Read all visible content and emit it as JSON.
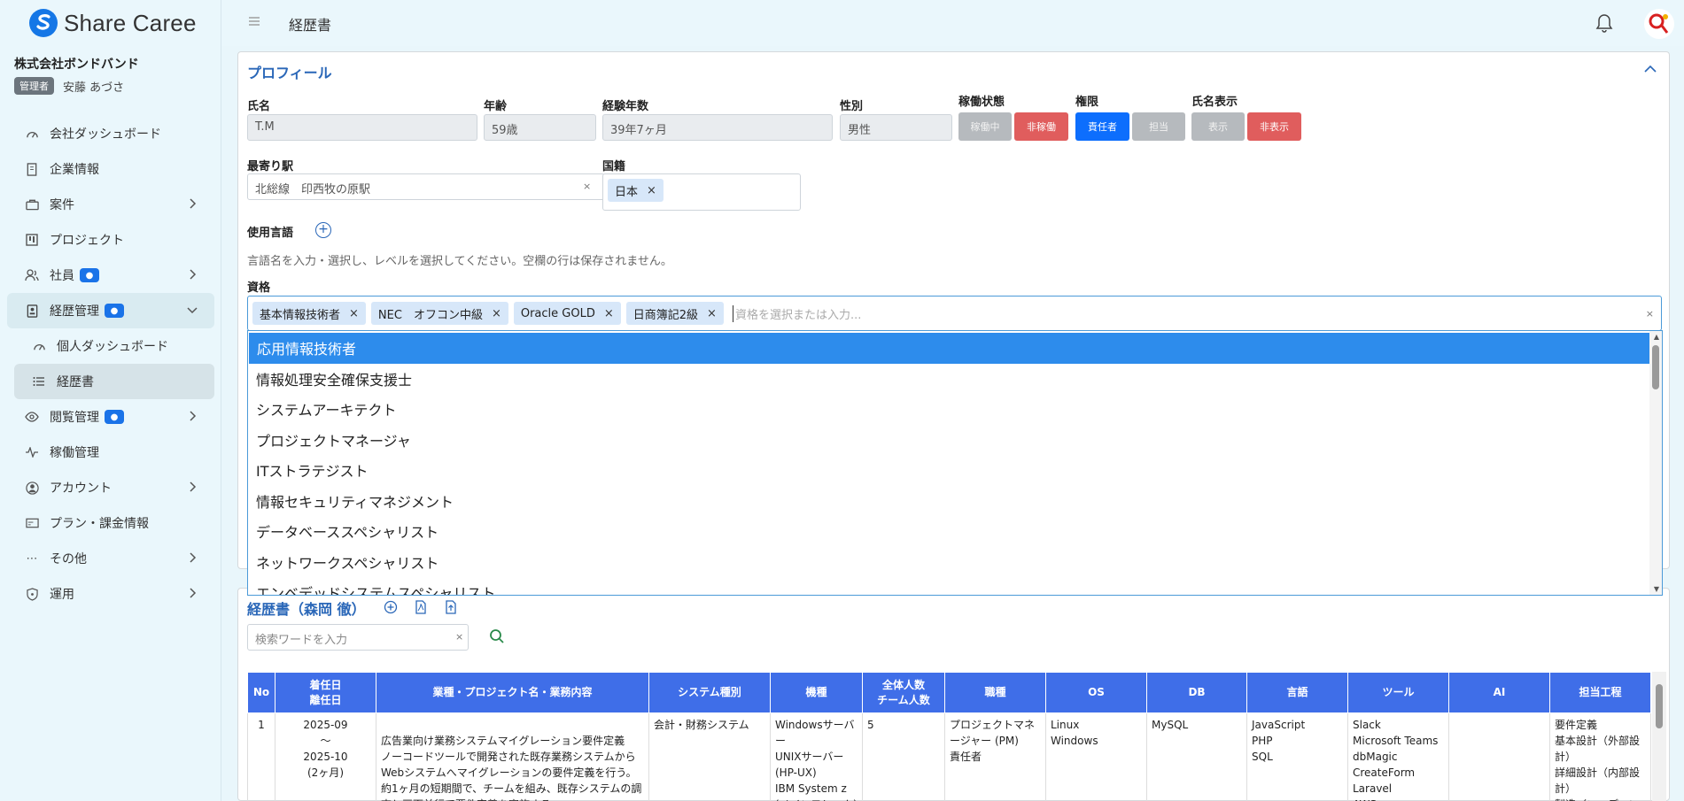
{
  "app": {
    "name": "Share Caree"
  },
  "sidebar": {
    "company": "株式会社ボンドバンド",
    "role_badge": "管理者",
    "user_name": "安藤 あづさ",
    "items": [
      {
        "label": "会社ダッシュボード",
        "icon": "dashboard-icon"
      },
      {
        "label": "企業情報",
        "icon": "building-icon"
      },
      {
        "label": "案件",
        "icon": "briefcase-icon"
      },
      {
        "label": "プロジェクト",
        "icon": "project-icon"
      },
      {
        "label": "社員",
        "icon": "users-icon"
      },
      {
        "label": "経歴管理",
        "icon": "id-card-icon"
      },
      {
        "label": "個人ダッシュボード",
        "icon": "dashboard-icon"
      },
      {
        "label": "経歴書",
        "icon": "list-icon"
      },
      {
        "label": "閲覧管理",
        "icon": "eye-icon"
      },
      {
        "label": "稼働管理",
        "icon": "activity-icon"
      },
      {
        "label": "アカウント",
        "icon": "account-icon"
      },
      {
        "label": "プラン・課金情報",
        "icon": "billing-icon"
      },
      {
        "label": "その他",
        "icon": "more-icon"
      },
      {
        "label": "運用",
        "icon": "shield-icon"
      }
    ]
  },
  "header": {
    "title": "経歴書"
  },
  "profile": {
    "title": "プロフィール",
    "name_label": "氏名",
    "name_value": "T.M",
    "age_label": "年齢",
    "age_value": "59歳",
    "exp_label": "経験年数",
    "exp_value": "39年7ヶ月",
    "gender_label": "性別",
    "gender_value": "男性",
    "status_label": "稼働状態",
    "status_active": "稼働中",
    "status_inactive": "非稼働",
    "perm_label": "権限",
    "perm_lead": "責任者",
    "perm_member": "担当",
    "disp_label": "氏名表示",
    "disp_show": "表示",
    "disp_hide": "非表示",
    "station_label": "最寄り駅",
    "station_value": "北総線　印西牧の原駅",
    "nation_label": "国籍",
    "nation_tag": "日本",
    "lang_label": "使用言語",
    "lang_hint": "言語名を入力・選択し、レベルを選択してください。空欄の行は保存されません。",
    "qual_label": "資格",
    "qual_tags": [
      "基本情報技術者",
      "NEC　オフコン中級",
      "Oracle GOLD",
      "日商簿記2級"
    ],
    "qual_placeholder": "資格を選択または入力..."
  },
  "dropdown": {
    "options": [
      "応用情報技術者",
      "情報処理安全確保支援士",
      "システムアーキテクト",
      "プロジェクトマネージャ",
      "ITストラテジスト",
      "情報セキュリティマネジメント",
      "データベーススペシャリスト",
      "ネットワークスペシャリスト",
      "エンベデッドシステムスペシャリスト"
    ]
  },
  "history": {
    "title": "経歴書（森岡 徹）",
    "search_placeholder": "検索ワードを入力",
    "headers": [
      "No",
      "着任日\n離任日",
      "業種・プロジェクト名・業務内容",
      "システム種別",
      "機種",
      "全体人数\nチーム人数",
      "職種",
      "OS",
      "DB",
      "言語",
      "ツール",
      "AI",
      "担当工程"
    ],
    "rows": [
      {
        "no": "1",
        "dates": "2025-09\n～\n2025-10\n(2ヶ月)",
        "content": "\n広告業向け業務システムマイグレーション要件定義\nノーコードツールで開発された既存業務システムからWebシステムへマイグレーションの要件定義を行う。約1ヶ月の短期間で、チームを組み、既存システムの調査と画面並行で要件定義を実施する。",
        "system": "会計・財務システム",
        "machine": "Windowsサーバー\nUNIXサーバー(HP-UX)\nIBM System z (メインフレーム)",
        "people": "5",
        "job": "プロジェクトマネージャー (PM)\n責任者",
        "os": "Linux\nWindows",
        "db": "MySQL",
        "lang": "JavaScript\nPHP\nSQL",
        "tools": "Slack\nMicrosoft Teams\ndbMagic\nCreateForm\nLaravel\nAWS",
        "ai": "",
        "process": "要件定義\n基本設計（外部設計）\n詳細設計（内部設計）\n製造（コーディング）"
      }
    ]
  }
}
